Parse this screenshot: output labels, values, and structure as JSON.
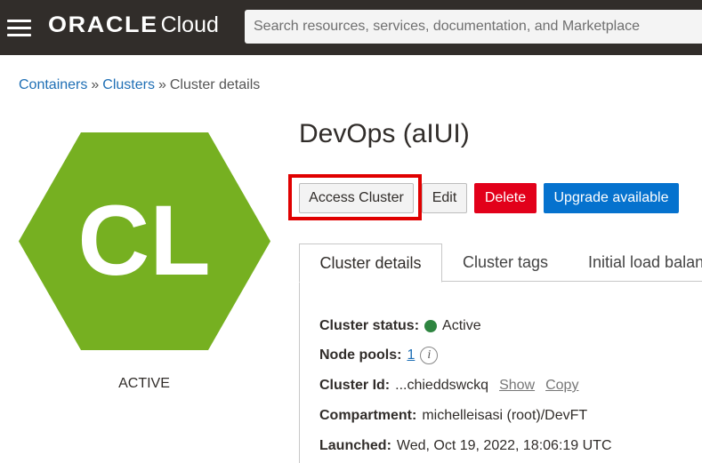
{
  "header": {
    "brand": "ORACLE",
    "product": "Cloud",
    "search_placeholder": "Search resources, services, documentation, and Marketplace"
  },
  "breadcrumb": {
    "items": [
      "Containers",
      "Clusters"
    ],
    "separator": "»",
    "current": "Cluster details"
  },
  "cluster": {
    "icon_text": "CL",
    "icon_color": "#76b021",
    "state": "ACTIVE",
    "title": "DevOps (aIUI)"
  },
  "actions": {
    "access_label": "Access Cluster",
    "edit_label": "Edit",
    "delete_label": "Delete",
    "upgrade_label": "Upgrade available",
    "delete_color": "#e2001a",
    "upgrade_color": "#0572ce"
  },
  "tabs": [
    "Cluster details",
    "Cluster tags",
    "Initial load balan"
  ],
  "details": {
    "status_label": "Cluster status:",
    "status_value": "Active",
    "status_color": "#2e8540",
    "node_pools_label": "Node pools:",
    "node_pools_value": "1",
    "cluster_id_label": "Cluster Id:",
    "cluster_id_value": "...chieddswckq",
    "show_label": "Show",
    "copy_label": "Copy",
    "compartment_label": "Compartment:",
    "compartment_value": "michelleisasi (root)/DevFT",
    "launched_label": "Launched:",
    "launched_value": "Wed, Oct 19, 2022, 18:06:19 UTC"
  },
  "icons": {
    "menu": "hamburger-menu-icon",
    "info": "info-icon",
    "status": "status-dot-icon"
  }
}
